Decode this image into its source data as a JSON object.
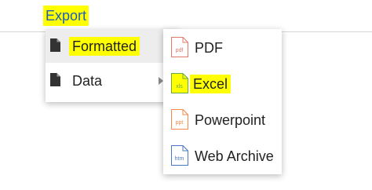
{
  "toolbar": {
    "export_label": "Export"
  },
  "primary_menu": {
    "items": [
      {
        "label": "Formatted",
        "has_submenu": false
      },
      {
        "label": "Data",
        "has_submenu": true
      }
    ]
  },
  "submenu": {
    "items": [
      {
        "label": "PDF",
        "icon_text": "pdf",
        "icon": "pdf-file-icon"
      },
      {
        "label": "Excel",
        "icon_text": "xls",
        "icon": "excel-file-icon"
      },
      {
        "label": "Powerpoint",
        "icon_text": "ppt",
        "icon": "powerpoint-file-icon"
      },
      {
        "label": "Web Archive",
        "icon_text": "htm",
        "icon": "web-archive-file-icon"
      }
    ]
  },
  "colors": {
    "highlight": "#ffff00",
    "export_text": "#1f5fb5",
    "pdf_icon": "#e07a6a",
    "excel_icon": "#6aa84f",
    "powerpoint_icon": "#f08a4b",
    "web_archive_icon": "#4a78c2"
  }
}
